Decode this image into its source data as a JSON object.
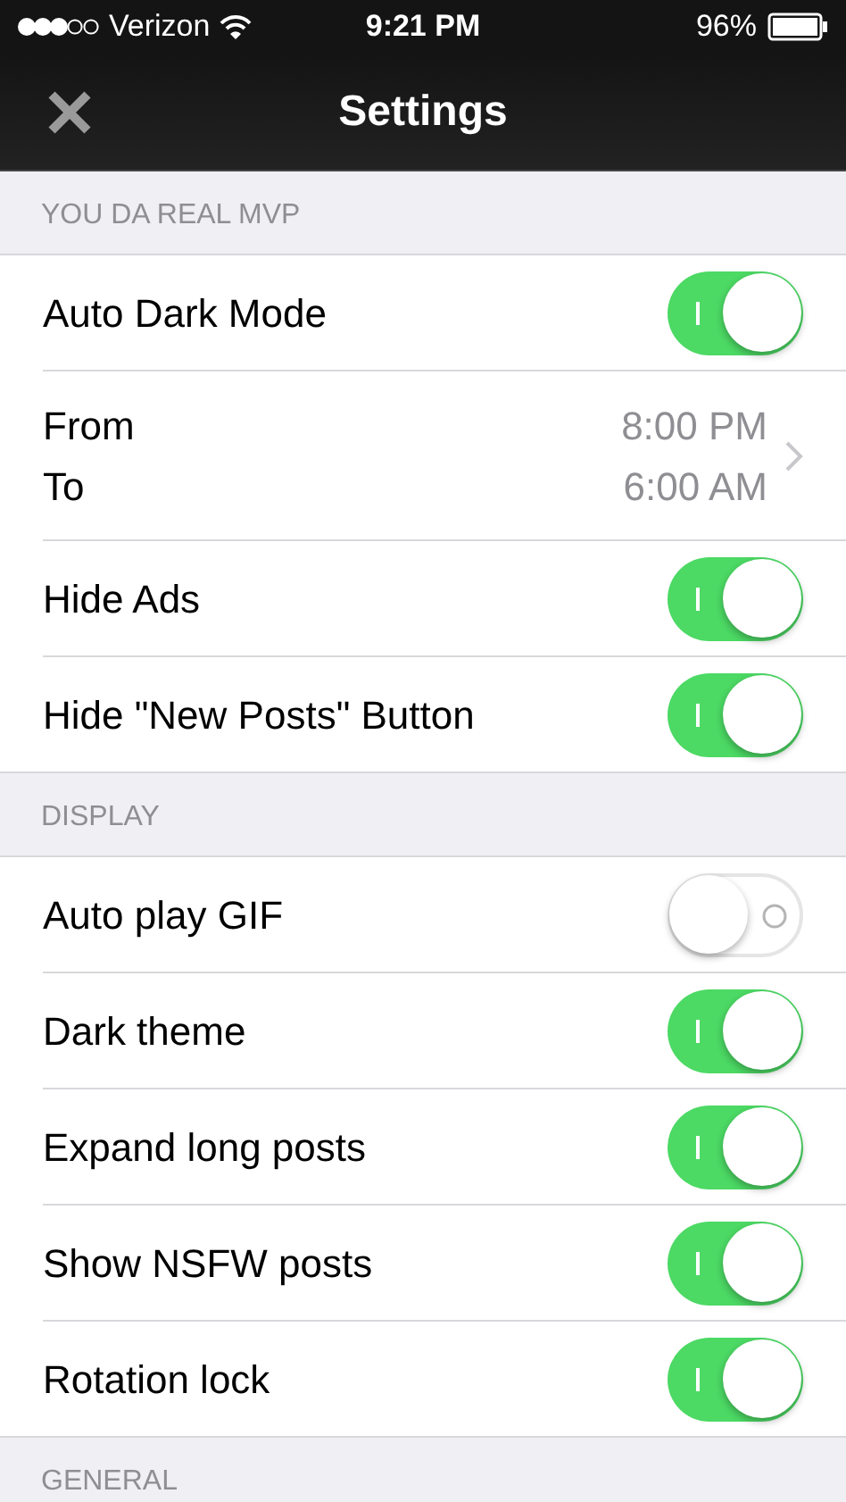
{
  "status_bar": {
    "carrier": "Verizon",
    "time": "9:21 PM",
    "battery": "96%"
  },
  "nav": {
    "title": "Settings"
  },
  "sections": [
    {
      "title": "YOU DA REAL MVP",
      "items": [
        {
          "kind": "toggle",
          "label": "Auto Dark Mode",
          "on": true
        },
        {
          "kind": "range",
          "from_label": "From",
          "to_label": "To",
          "from_value": "8:00 PM",
          "to_value": "6:00 AM"
        },
        {
          "kind": "toggle",
          "label": "Hide Ads",
          "on": true
        },
        {
          "kind": "toggle",
          "label": "Hide \"New Posts\" Button",
          "on": true
        }
      ]
    },
    {
      "title": "DISPLAY",
      "items": [
        {
          "kind": "toggle",
          "label": "Auto play GIF",
          "on": false
        },
        {
          "kind": "toggle",
          "label": "Dark theme",
          "on": true
        },
        {
          "kind": "toggle",
          "label": "Expand long posts",
          "on": true
        },
        {
          "kind": "toggle",
          "label": "Show NSFW posts",
          "on": true
        },
        {
          "kind": "toggle",
          "label": "Rotation lock",
          "on": true
        }
      ]
    },
    {
      "title": "GENERAL"
    }
  ]
}
